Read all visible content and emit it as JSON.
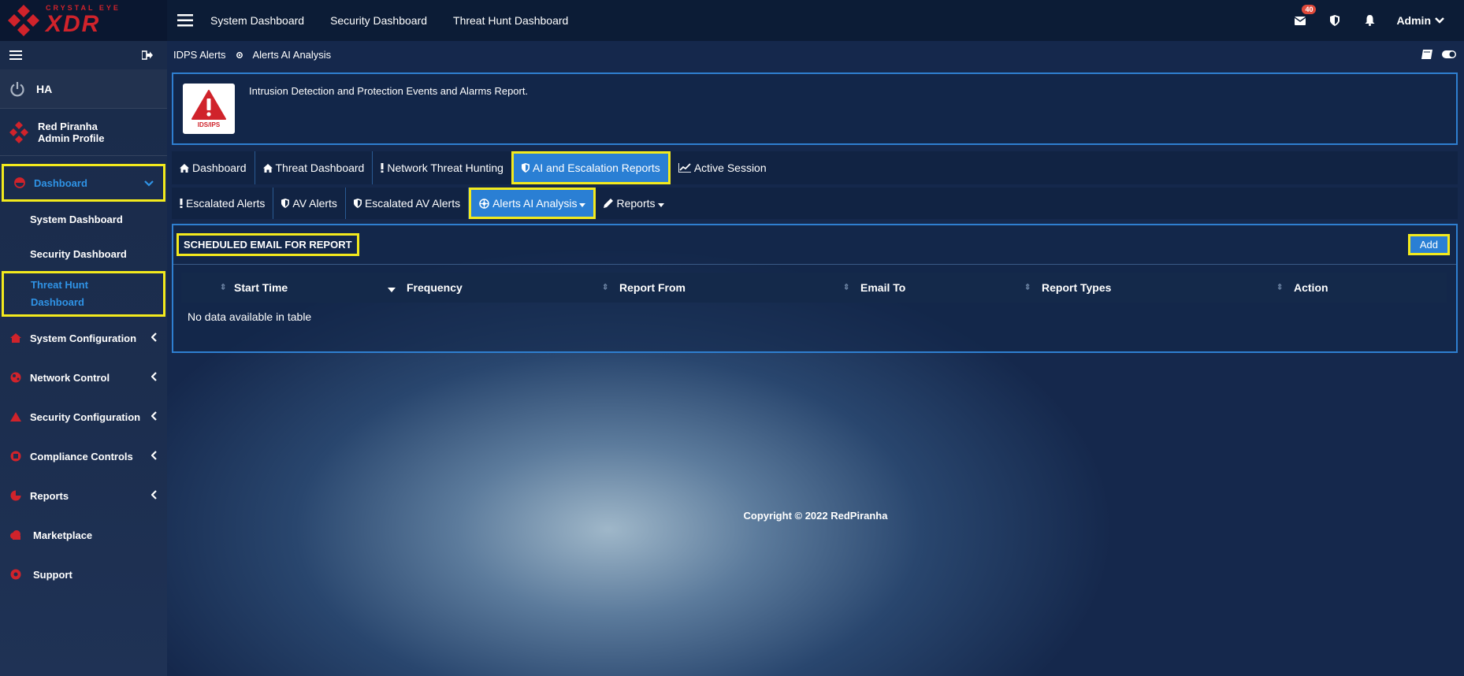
{
  "brand": {
    "small": "CRYSTAL EYE",
    "big": "XDR"
  },
  "topnav": [
    "System Dashboard",
    "Security Dashboard",
    "Threat Hunt Dashboard"
  ],
  "topbar": {
    "mail_count": "40",
    "user": "Admin"
  },
  "sidebar": {
    "ha_label": "HA",
    "profile_line1": "Red Piranha",
    "profile_line2": "Admin Profile",
    "dashboard_label": "Dashboard",
    "sub_items": [
      "System Dashboard",
      "Security Dashboard"
    ],
    "threat_hunt_line1": "Threat Hunt",
    "threat_hunt_line2": "Dashboard",
    "items": [
      "System Configuration",
      "Network Control",
      "Security Configuration",
      "Compliance Controls",
      "Reports",
      "Marketplace",
      "Support"
    ]
  },
  "breadcrumb": {
    "parent": "IDPS Alerts",
    "current": "Alerts AI Analysis"
  },
  "info": {
    "card_label": "IDS/IPS",
    "description": "Intrusion Detection and Protection Events and Alarms Report."
  },
  "tabs_primary": [
    "Dashboard",
    "Threat Dashboard",
    "Network Threat Hunting",
    "AI and Escalation Reports",
    "Active Session"
  ],
  "tabs_secondary": [
    "Escalated Alerts",
    "AV Alerts",
    "Escalated AV Alerts",
    "Alerts AI Analysis",
    "Reports"
  ],
  "panel": {
    "title": "SCHEDULED EMAIL FOR REPORT",
    "add_label": "Add",
    "columns": [
      "Start Time",
      "Frequency",
      "Report From",
      "Email To",
      "Report Types",
      "Action"
    ],
    "empty_message": "No data available in table"
  },
  "footer": {
    "copyright": "Copyright © 2022 RedPiranha"
  },
  "colors": {
    "accent": "#2a7fd4",
    "highlight": "#f3ea1d",
    "brand_red": "#d0232b"
  }
}
